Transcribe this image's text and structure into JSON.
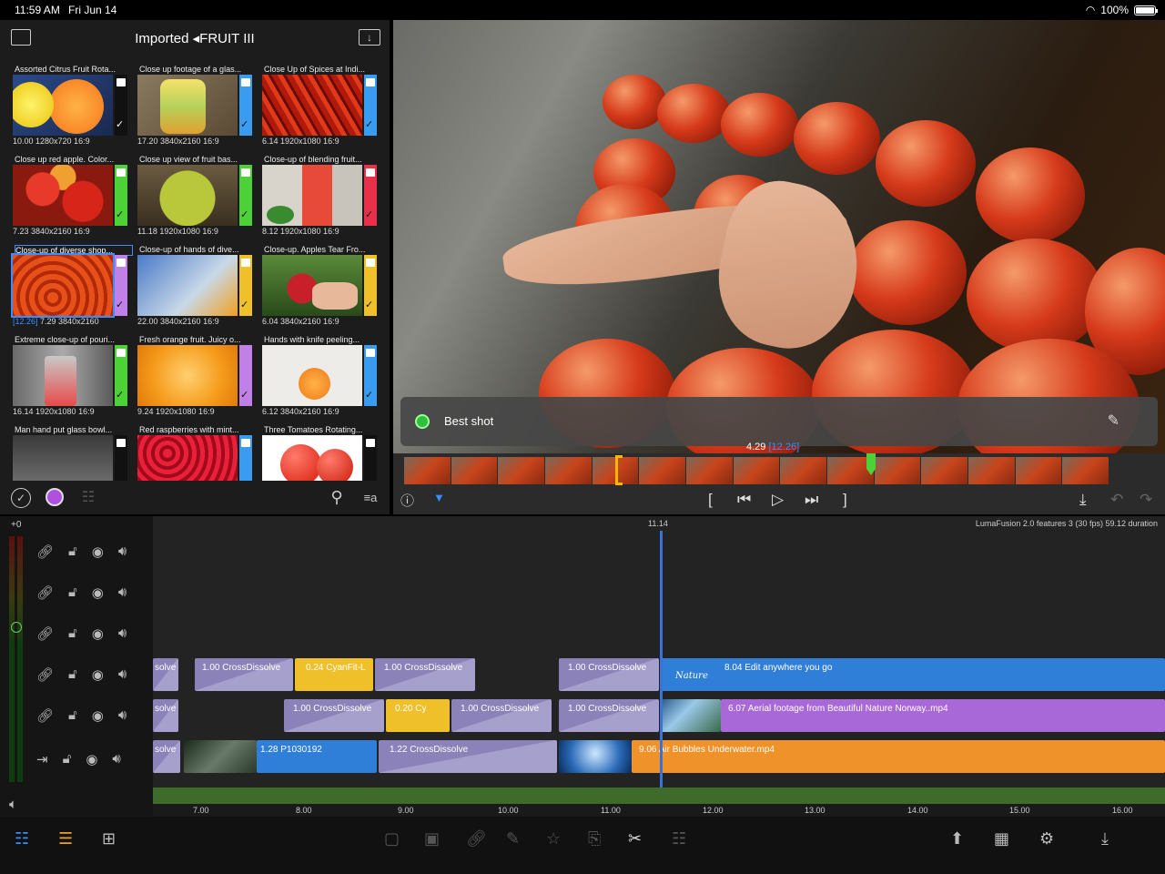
{
  "status": {
    "time": "11:59 AM",
    "date": "Fri Jun 14",
    "battery": "100%"
  },
  "library": {
    "title": "Imported ◂FRUIT III",
    "clips": [
      {
        "name": "Assorted Citrus Fruit Rota...",
        "meta": "10.00  1280x720  16:9"
      },
      {
        "name": "Close up footage of a glas...",
        "meta": "17.20  3840x2160  16:9"
      },
      {
        "name": "Close Up of Spices at Indi...",
        "meta": "6.14  1920x1080  16:9"
      },
      {
        "name": "Close up red apple. Color...",
        "meta": "7.23  3840x2160  16:9"
      },
      {
        "name": "Close up view of fruit bas...",
        "meta": "11.18  1920x1080  16:9"
      },
      {
        "name": "Close-up of blending fruit...",
        "meta": "8.12  1920x1080  16:9"
      },
      {
        "name": "Close-up of diverse shop...",
        "meta_prefix": "[12.26]",
        "meta": " 7.29  3840x2160"
      },
      {
        "name": "Close-up of hands of dive...",
        "meta": "22.00  3840x2160  16:9"
      },
      {
        "name": "Close-up. Apples Tear Fro...",
        "meta": "6.04  3840x2160  16:9"
      },
      {
        "name": "Extreme close-up of pouri...",
        "meta": "16.14  1920x1080  16:9"
      },
      {
        "name": "Fresh orange fruit. Juicy o...",
        "meta": "9.24  1920x1080  16:9"
      },
      {
        "name": "Hands with knife peeling...",
        "meta": "6.12  3840x2160  16:9"
      },
      {
        "name": "Man hand put glass bowl...",
        "meta": ""
      },
      {
        "name": "Red raspberries with mint...",
        "meta": ""
      },
      {
        "name": "Three Tomatoes Rotating...",
        "meta": ""
      }
    ]
  },
  "viewer": {
    "note": "Best shot",
    "scrub_time": "4.29",
    "scrub_total": "[12.26]"
  },
  "timeline": {
    "zero": "+0",
    "playhead_time": "11.14",
    "info": "LumaFusion 2.0 features 3 (30 fps)  59.12 duration",
    "clips": {
      "t1_a": "solve",
      "t1_b": "1.00  CrossDissolve",
      "t1_c": "0.24  CyanFit-L",
      "t1_d": "1.00  CrossDissolve",
      "t1_e": "1.00  CrossDissolve",
      "t1_f": "8.04   Edit anywhere you go",
      "t1_f_sub": "Nature",
      "t2_a": "solve",
      "t2_b": "1.00  CrossDissolve",
      "t2_c": "0.20  Cy",
      "t2_d": "1.00  CrossDissolve",
      "t2_e": "1.00  CrossDissolve",
      "t2_f": "6.07   Aerial footage from Beautiful Nature Norway..mp4",
      "t3_a": "solve",
      "t3_b": "1.28   P1030192",
      "t3_c": "1.22   CrossDissolve",
      "t3_d": "9.06   Air Bubbles Underwater.mp4"
    },
    "ruler": [
      "7.00",
      "8.00",
      "9.00",
      "10.00",
      "11.00",
      "12.00",
      "13.00",
      "14.00",
      "15.00",
      "16.00"
    ]
  }
}
